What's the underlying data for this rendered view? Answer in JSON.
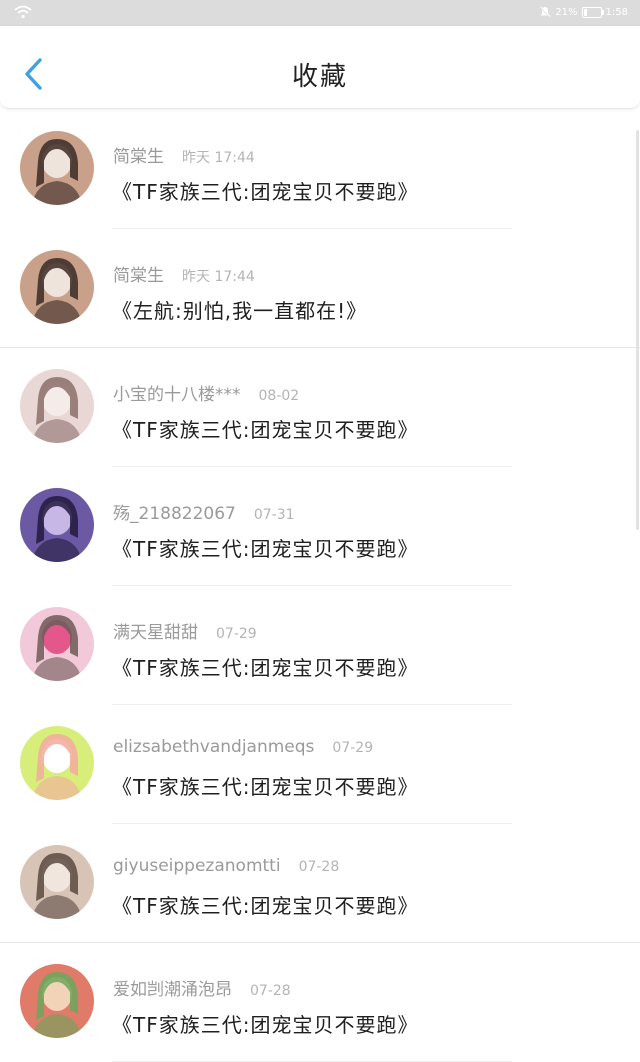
{
  "statusbar": {
    "battery": "21%",
    "time": "1:58",
    "battery_level": 0.21
  },
  "header": {
    "title": "收藏"
  },
  "items": [
    {
      "name": "简棠生",
      "time": "昨天 17:44",
      "content": "《TF家族三代:团宠宝贝不要跑》",
      "avatar_colors": [
        "#c9a08a",
        "#3a2a24",
        "#efe4dc"
      ]
    },
    {
      "name": "简棠生",
      "time": "昨天 17:44",
      "content": "《左航:别怕,我一直都在!》",
      "avatar_colors": [
        "#c9a08a",
        "#3a2a24",
        "#efe4dc"
      ]
    },
    {
      "name": "小宝的十八楼***",
      "time": "08-02",
      "content": "《TF家族三代:团宠宝贝不要跑》",
      "avatar_colors": [
        "#e9d7d6",
        "#8b6f6a",
        "#f4ece9"
      ]
    },
    {
      "name": "殇_218822067",
      "time": "07-31",
      "content": "《TF家族三代:团宠宝贝不要跑》",
      "avatar_colors": [
        "#6b5aa3",
        "#231a3d",
        "#c7b7e6"
      ]
    },
    {
      "name": "满天星甜甜",
      "time": "07-29",
      "content": "《TF家族三代:团宠宝贝不要跑》",
      "avatar_colors": [
        "#f2c9d8",
        "#6d5a58",
        "#e4578a"
      ]
    },
    {
      "name": "elizsabethvandjanmeqs",
      "time": "07-29",
      "content": "《TF家族三代:团宠宝贝不要跑》",
      "avatar_colors": [
        "#d7ef7a",
        "#f4a9a0",
        "#ffffff"
      ]
    },
    {
      "name": "giyuseippezanomtti",
      "time": "07-28",
      "content": "《TF家族三代:团宠宝贝不要跑》",
      "avatar_colors": [
        "#d8c4b6",
        "#5c4a42",
        "#f0e6de"
      ]
    },
    {
      "name": "爱如剀潮涌泡昂",
      "time": "07-28",
      "content": "《TF家族三代:团宠宝贝不要跑》",
      "avatar_colors": [
        "#e07b6a",
        "#6aa75a",
        "#f3d3b7"
      ]
    }
  ],
  "colors": {
    "accent": "#3da1e6",
    "status_bar": "#dcdcdc"
  }
}
